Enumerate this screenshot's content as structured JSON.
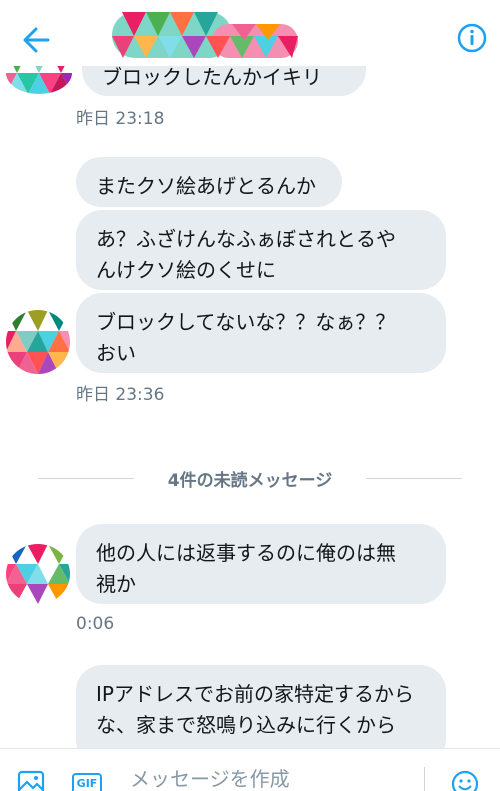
{
  "header": {
    "back_icon": "arrow-left-icon",
    "info_icon": "info-icon",
    "accent_color": "#1da1f2"
  },
  "messages": {
    "partial_top": "ブロックしたんかイキリ",
    "ts1": "昨日 23:18",
    "m1": "またクソ絵あげとるんか",
    "m2": "あ？ふざけんなふぁぼされとるや\nんけクソ絵のくせに",
    "m3": "ブロックしてないな？？なぁ？？\nおい",
    "ts2": "昨日 23:36",
    "unread_divider": "4件の未読メッセージ",
    "m4": "他の人には返事するのに俺のは無\n視か",
    "ts3": "0:06",
    "m5": "IPアドレスでお前の家特定するから\nな、家まで怒鳴り込みに行くから"
  },
  "composer": {
    "placeholder": "メッセージを作成",
    "gif_label": "GIF",
    "image_icon": "image-icon",
    "emoji_icon": "emoji-icon"
  },
  "colors": {
    "bubble_bg": "#e6ecf0",
    "secondary_text": "#657786",
    "accent": "#1da1f2"
  }
}
